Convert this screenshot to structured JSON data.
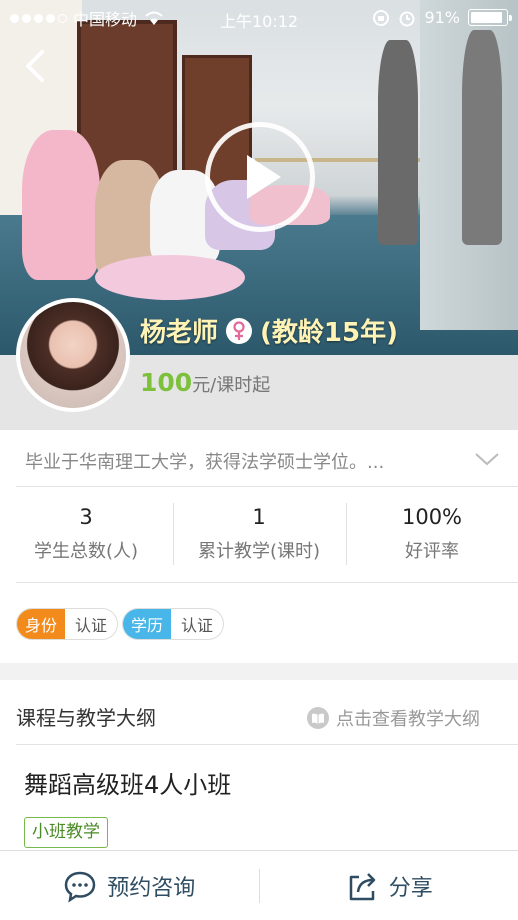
{
  "status_bar": {
    "carrier": "中国移动",
    "time": "上午10:12",
    "battery_percent": "91%",
    "battery_level": 0.91,
    "signal_dots_filled": 4,
    "signal_dots_total": 5
  },
  "video": {
    "play_icon": "play-icon"
  },
  "teacher": {
    "name": "杨老师",
    "gender_icon": "female-symbol",
    "seniority": "(教龄15年)",
    "price_value": "100",
    "price_unit": "元/课时起",
    "intro": "毕业于华南理工大学，获得法学硕士学位。..."
  },
  "stats": [
    {
      "value": "3",
      "label": "学生总数(人)"
    },
    {
      "value": "1",
      "label": "累计教学(课时)"
    },
    {
      "value": "100%",
      "label": "好评率"
    }
  ],
  "badges": [
    {
      "tag": "身份",
      "text": "认证",
      "color": "#f38b1c"
    },
    {
      "tag": "学历",
      "text": "认证",
      "color": "#48b6e8"
    }
  ],
  "course_section": {
    "title": "课程与教学大纲",
    "syllabus_link": "点击查看教学大纲",
    "course_name": "舞蹈高级班4人小班",
    "tag": "小班教学"
  },
  "bottom_bar": {
    "consult": "预约咨询",
    "share": "分享"
  },
  "colors": {
    "price_green": "#7cc03c",
    "tag_green": "#77b94b",
    "title_yellow": "#fff3b5"
  }
}
